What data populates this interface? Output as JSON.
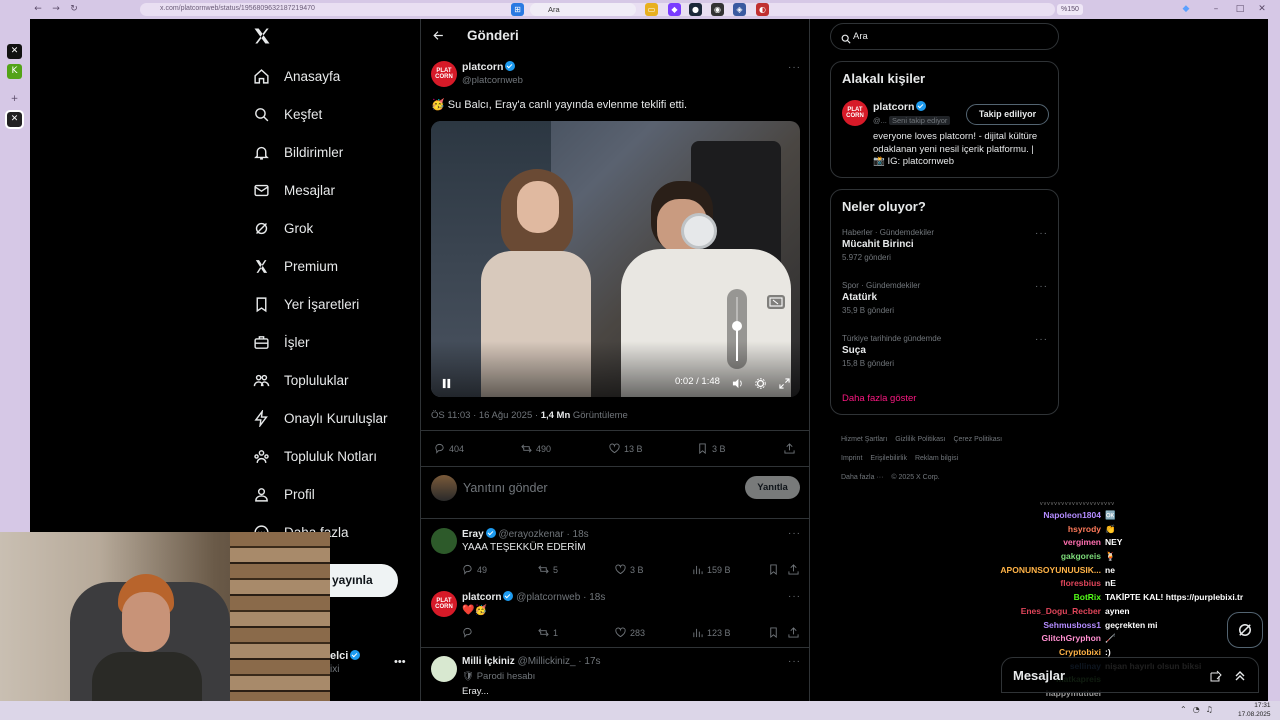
{
  "browser": {
    "url": "x.com/platcornweb/status/1956809632187219470",
    "zoom": "%150"
  },
  "nav": {
    "items": [
      {
        "label": "Anasayfa",
        "icon": "home-icon"
      },
      {
        "label": "Keşfet",
        "icon": "search-icon"
      },
      {
        "label": "Bildirimler",
        "icon": "bell-icon"
      },
      {
        "label": "Mesajlar",
        "icon": "mail-icon"
      },
      {
        "label": "Grok",
        "icon": "grok-icon"
      },
      {
        "label": "Premium",
        "icon": "x-logo-icon"
      },
      {
        "label": "Yer İşaretleri",
        "icon": "bookmark-icon"
      },
      {
        "label": "İşler",
        "icon": "briefcase-icon"
      },
      {
        "label": "Topluluklar",
        "icon": "people-icon"
      },
      {
        "label": "Onaylı Kuruluşlar",
        "icon": "lightning-icon"
      },
      {
        "label": "Topluluk Notları",
        "icon": "community-notes-icon"
      },
      {
        "label": "Profil",
        "icon": "person-icon"
      },
      {
        "label": "Daha fazla",
        "icon": "more-circle-icon"
      }
    ],
    "post_button": "yayınla",
    "account_name": "elci",
    "account_handle": "ixi"
  },
  "header": {
    "title": "Gönderi"
  },
  "post": {
    "author": "platcorn",
    "handle": "@platcornweb",
    "text": "🥳 Su Balcı, Eray'a canlı yayında evlenme teklifi etti.",
    "video": {
      "time": "0:02 / 1:48",
      "volume": 0.55
    },
    "meta_time": "ÖS 11:03 · 16 Ağu 2025 · ",
    "views": "1,4 Mn",
    "views_label": " Görüntüleme",
    "stats": {
      "replies": "404",
      "reposts": "490",
      "likes": "13 B",
      "bookmarks": "3 B"
    }
  },
  "reply_box": {
    "placeholder": "Yanıtını gönder",
    "button": "Yanıtla"
  },
  "replies": [
    {
      "author": "Eray",
      "handle": "@erayozkenar",
      "time": "· 18s",
      "text": "YAAA TEŞEKKÜR EDERİM",
      "stats": {
        "replies": "49",
        "reposts": "5",
        "likes": "3 B",
        "views": "159 B"
      }
    },
    {
      "author": "platcorn",
      "handle": "@platcornweb",
      "time": "· 18s",
      "text": "❤️🥳",
      "stats": {
        "replies": "",
        "reposts": "1",
        "likes": "283",
        "views": "123 B"
      }
    },
    {
      "author": "Milli İçkiniz",
      "handle": "@Millickiniz_",
      "time": "· 17s",
      "text": "🛡 Parodi hesabı",
      "cut_text": "Eray..."
    }
  ],
  "search": {
    "placeholder": "Ara"
  },
  "related": {
    "title": "Alakalı kişiler",
    "name": "platcorn",
    "handle": "@...",
    "follows_you": "Seni takip ediyor",
    "button": "Takip ediliyor",
    "bio": "everyone loves platcorn! - dijital kültüre odaklanan yeni nesil içerik platformu. | 📸 IG: platcornweb"
  },
  "trends": {
    "title": "Neler oluyor?",
    "items": [
      {
        "category": "Haberler · Gündemdekiler",
        "name": "Mücahit Birinci",
        "count": "5.972 gönderi"
      },
      {
        "category": "Spor · Gündemdekiler",
        "name": "Atatürk",
        "count": "35,9 B gönderi"
      },
      {
        "category": "Türkiye tarihinde gündemde",
        "name": "Suça",
        "count": "15,8 B gönderi"
      }
    ],
    "more": "Daha fazla göster"
  },
  "footer": {
    "links": [
      "Hizmet Şartları",
      "Gizlilik Politikası",
      "Çerez Politikası",
      "Imprint",
      "Erişilebilirlik",
      "Reklam bilgisi",
      "Daha fazla ···",
      "© 2025 X Corp."
    ]
  },
  "chat": [
    {
      "user": "Napoleon1804",
      "msg": "🆗",
      "color": "#b48cff"
    },
    {
      "user": "hsyrody",
      "msg": "👏",
      "color": "#ff7a5a"
    },
    {
      "user": "vergimen",
      "msg": "NEY",
      "color": "#ff6fb0"
    },
    {
      "user": "gakgoreis",
      "msg": "🍹",
      "color": "#7ddc7a"
    },
    {
      "user": "APONUNSOYUNUUSIK...",
      "msg": "ne",
      "color": "#ffb347"
    },
    {
      "user": "floresbius",
      "msg": "nE",
      "color": "#e0455a"
    },
    {
      "user": "BotRix",
      "msg": "TAKİPTE KAL! https://purplebixi.tr",
      "color": "#53fc18"
    },
    {
      "user": "Enes_Dogu_Recber",
      "msg": "aynen",
      "color": "#e0455a"
    },
    {
      "user": "Sehmusboss1",
      "msg": "geçrekten mi",
      "color": "#b48cff"
    },
    {
      "user": "GlitchGryphon",
      "msg": "🦯",
      "color": "#ff8fd0"
    },
    {
      "user": "Cryptobixi",
      "msg": ":)",
      "color": "#ffb347"
    },
    {
      "user": "sellinay",
      "msg": "nişan hayırlı olsun biksi",
      "color": "#6aa8ff"
    },
    {
      "user": "matkapreis",
      "msg": "",
      "color": "#7ddc7a"
    },
    {
      "user": "happymutluel",
      "msg": "",
      "color": "#9a9a9a"
    }
  ],
  "messages_panel": {
    "title": "Mesajlar"
  },
  "taskbar": {
    "search": "Ara",
    "time": "17:31",
    "date": "17.08.2025"
  },
  "colors": {
    "accent": "#1d9bf0",
    "pink_link": "#f91880",
    "brand_red": "#d71a28"
  }
}
